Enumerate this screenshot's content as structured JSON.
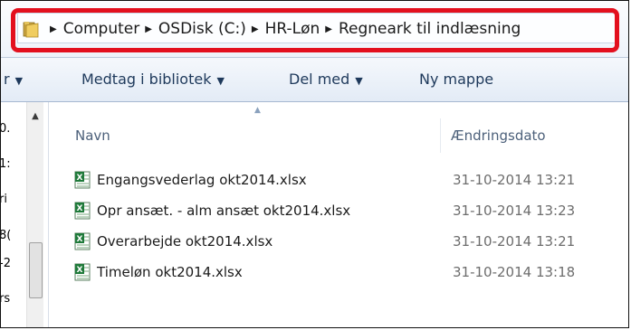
{
  "address_bar": {
    "crumbs": [
      "Computer",
      "OSDisk (C:)",
      "HR-Løn",
      "Regneark til indlæsning"
    ]
  },
  "toolbar": {
    "organize_partial": "r",
    "include_in_library": "Medtag i bibliotek",
    "share_with": "Del med",
    "new_folder": "Ny mappe"
  },
  "nav_pane": {
    "partial_items": [
      "0.",
      "1:",
      "ri",
      "8(",
      "-2",
      "rs"
    ]
  },
  "columns": {
    "name": "Navn",
    "date_modified": "Ændringsdato"
  },
  "files": [
    {
      "name": "Engangsvederlag okt2014.xlsx",
      "modified": "31-10-2014 13:21"
    },
    {
      "name": "Opr ansæt. - alm ansæt okt2014.xlsx",
      "modified": "31-10-2014 13:23"
    },
    {
      "name": "Overarbejde okt2014.xlsx",
      "modified": "31-10-2014 13:21"
    },
    {
      "name": "Timeløn okt2014.xlsx",
      "modified": "31-10-2014 13:18"
    }
  ],
  "colors": {
    "highlight_border": "#e3101e",
    "excel_green": "#1f7a3a"
  }
}
